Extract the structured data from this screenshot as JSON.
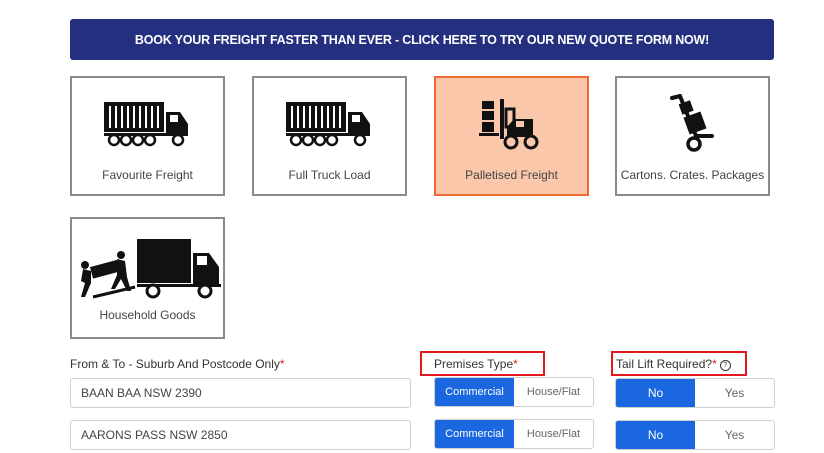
{
  "banner": {
    "text": "BOOK YOUR FREIGHT FASTER THAN EVER - CLICK HERE TO TRY OUR NEW QUOTE FORM NOW!"
  },
  "freight_types": [
    {
      "label": "Favourite Freight",
      "icon": "truck-icon",
      "selected": false
    },
    {
      "label": "Full Truck Load",
      "icon": "truck-icon",
      "selected": false
    },
    {
      "label": "Palletised Freight",
      "icon": "forklift-icon",
      "selected": true
    },
    {
      "label": "Cartons. Crates. Packages",
      "icon": "hand-trolley-icon",
      "selected": false
    },
    {
      "label": "Household Goods",
      "icon": "removalists-truck-icon",
      "selected": false
    }
  ],
  "form": {
    "from_to_label": "From & To - Suburb And Postcode Only",
    "premises_label": "Premises Type",
    "tail_lift_label": "Tail Lift Required?",
    "required_mark": "*",
    "help_glyph": "?",
    "rows": [
      {
        "location": "BAAN BAA NSW 2390",
        "premises": [
          "Commercial",
          "House/Flat"
        ],
        "premises_selected": "Commercial",
        "tail_lift": [
          "No",
          "Yes"
        ],
        "tail_lift_selected": "No"
      },
      {
        "location": "AARONS PASS NSW 2850",
        "premises": [
          "Commercial",
          "House/Flat"
        ],
        "premises_selected": "Commercial",
        "tail_lift": [
          "No",
          "Yes"
        ],
        "tail_lift_selected": "No"
      }
    ]
  },
  "colors": {
    "banner_bg": "#24307f",
    "selected_card_bg": "#fac7ab",
    "selected_card_border": "#ef6a33",
    "active_toggle": "#1a67e0",
    "highlight_box": "#e1191e"
  }
}
